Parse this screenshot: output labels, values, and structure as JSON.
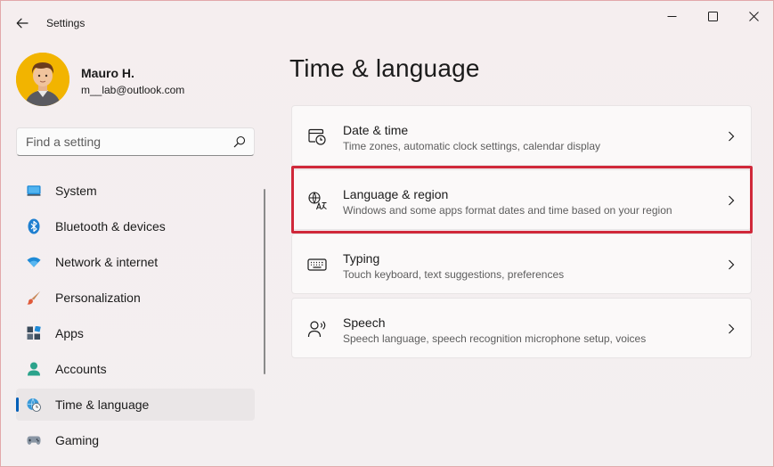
{
  "window": {
    "app_title": "Settings",
    "back_icon": "back-arrow-icon",
    "controls": [
      "minimize-icon",
      "maximize-icon",
      "close-icon"
    ]
  },
  "profile": {
    "name": "Mauro H.",
    "email": "m__lab@outlook.com"
  },
  "search": {
    "placeholder": "Find a setting",
    "value": ""
  },
  "sidebar": {
    "items": [
      {
        "label": "System",
        "icon": "monitor-icon",
        "selected": false
      },
      {
        "label": "Bluetooth & devices",
        "icon": "bluetooth-icon",
        "selected": false
      },
      {
        "label": "Network & internet",
        "icon": "wifi-icon",
        "selected": false
      },
      {
        "label": "Personalization",
        "icon": "brush-icon",
        "selected": false
      },
      {
        "label": "Apps",
        "icon": "apps-icon",
        "selected": false
      },
      {
        "label": "Accounts",
        "icon": "person-icon",
        "selected": false
      },
      {
        "label": "Time & language",
        "icon": "globe-clock-icon",
        "selected": true
      },
      {
        "label": "Gaming",
        "icon": "gamepad-icon",
        "selected": false
      }
    ]
  },
  "main": {
    "title": "Time & language",
    "cards": [
      {
        "title": "Date & time",
        "subtitle": "Time zones, automatic clock settings, calendar display",
        "icon": "calendar-clock-icon"
      },
      {
        "title": "Language & region",
        "subtitle": "Windows and some apps format dates and time based on your region",
        "icon": "language-icon",
        "highlighted": true
      },
      {
        "title": "Typing",
        "subtitle": "Touch keyboard, text suggestions, preferences",
        "icon": "keyboard-icon"
      },
      {
        "title": "Speech",
        "subtitle": "Speech language, speech recognition microphone setup, voices",
        "icon": "speech-icon"
      }
    ]
  },
  "colors": {
    "accent": "#005fb8",
    "highlight_border": "#d0283a",
    "avatar_bg": "#f2b400"
  }
}
